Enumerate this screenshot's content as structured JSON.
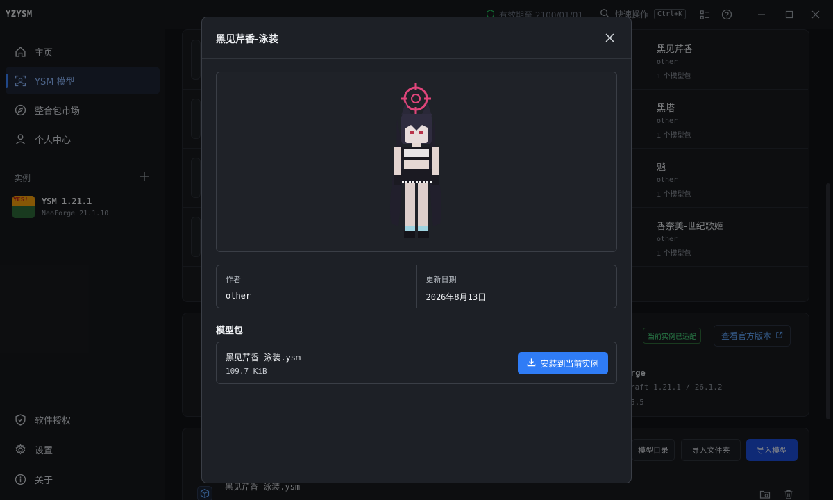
{
  "app": {
    "name": "YZYSM"
  },
  "titlebar": {
    "validity": "有效期至 2100/01/01",
    "quick_action": "快速操作",
    "shortcut": "Ctrl+K"
  },
  "sidebar": {
    "items": [
      {
        "label": "主页",
        "icon": "home-icon"
      },
      {
        "label": "YSM 模型",
        "icon": "scan-icon"
      },
      {
        "label": "整合包市场",
        "icon": "compass-icon"
      },
      {
        "label": "个人中心",
        "icon": "user-icon"
      }
    ],
    "instances_label": "实例",
    "instance": {
      "name": "YSM 1.21.1",
      "loader": "NeoForge 21.1.10",
      "thumb_text": "YES!"
    },
    "bottom_items": [
      {
        "label": "软件授权",
        "icon": "shield-icon"
      },
      {
        "label": "设置",
        "icon": "gear-icon"
      },
      {
        "label": "关于",
        "icon": "info-icon"
      }
    ]
  },
  "background": {
    "models": [
      {
        "name": "黑见芹香",
        "author": "other",
        "count": "1 个模型包"
      },
      {
        "name": "黑塔",
        "author": "other",
        "count": "1 个模型包"
      },
      {
        "name": "魈",
        "author": "other",
        "count": "1 个模型包"
      },
      {
        "name": "香奈美-世纪歌姬",
        "author": "other",
        "count": "1 个模型包"
      }
    ],
    "compat_badge": "当前实例已适配",
    "view_official": "查看官方版本",
    "version_text": "raft 1.21.1 / 26.1.2",
    "version_text2": "6.5",
    "forge_text": "rge",
    "btn_model_dir": "模型目录",
    "btn_import_folder": "导入文件夹",
    "btn_import_model": "导入模型",
    "file_name": "黑见芹香-泳装.ysm"
  },
  "modal": {
    "title": "黑见芹香-泳装",
    "author_label": "作者",
    "author": "other",
    "date_label": "更新日期",
    "date": "2026年8月13日",
    "packages_title": "模型包",
    "package": {
      "name": "黑见芹香-泳装.ysm",
      "size": "109.7 KiB"
    },
    "install_label": "安装到当前实例"
  },
  "colors": {
    "accent": "#2f7cf6",
    "success": "#4ade80",
    "character_halo": "#e0457b"
  }
}
